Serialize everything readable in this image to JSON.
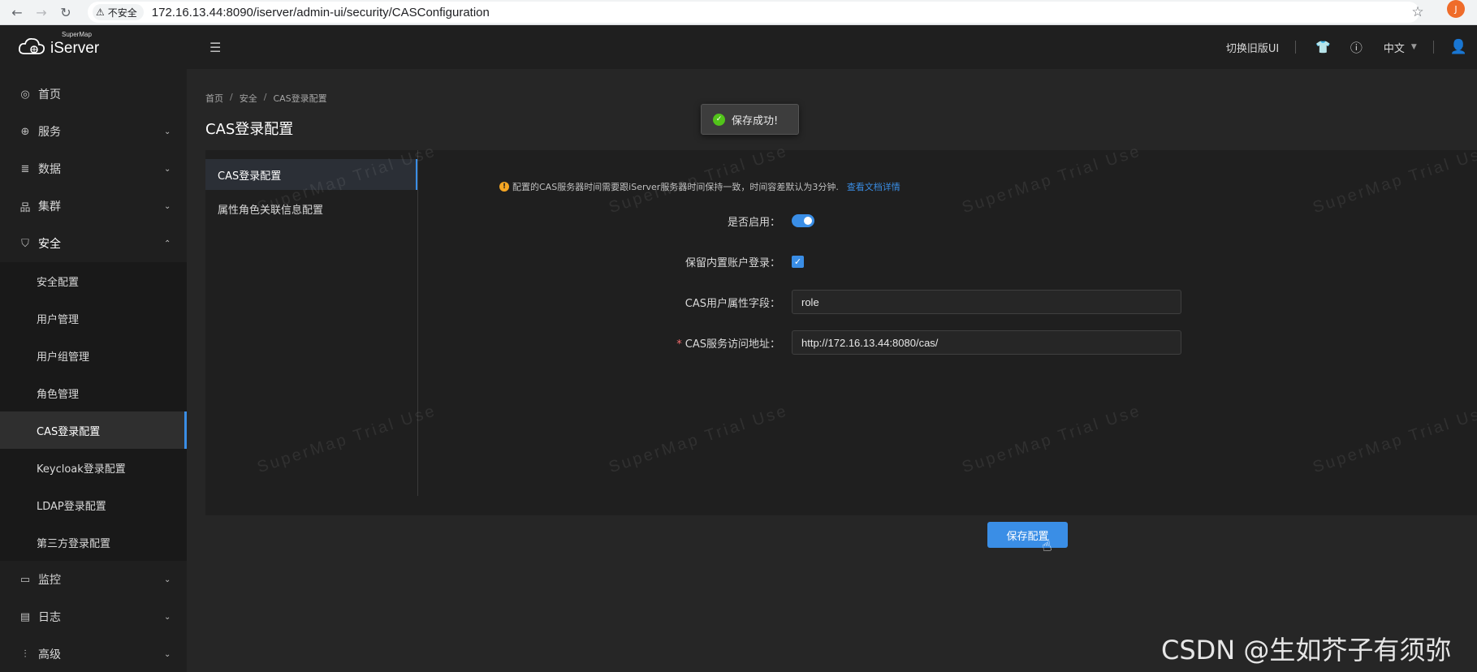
{
  "browser": {
    "security_label": "不安全",
    "url": "172.16.13.44:8090/iserver/admin-ui/security/CASConfiguration",
    "profile_initial": "J"
  },
  "header": {
    "logo_small": "SuperMap",
    "logo_big": "iServer",
    "switch_ui": "切换旧版UI",
    "language": "中文"
  },
  "sidebar": {
    "items": [
      {
        "label": "首页"
      },
      {
        "label": "服务"
      },
      {
        "label": "数据"
      },
      {
        "label": "集群"
      },
      {
        "label": "安全"
      }
    ],
    "security_sub": [
      {
        "label": "安全配置"
      },
      {
        "label": "用户管理"
      },
      {
        "label": "用户组管理"
      },
      {
        "label": "角色管理"
      },
      {
        "label": "CAS登录配置"
      },
      {
        "label": "Keycloak登录配置"
      },
      {
        "label": "LDAP登录配置"
      },
      {
        "label": "第三方登录配置"
      }
    ],
    "bottom_items": [
      {
        "label": "监控"
      },
      {
        "label": "日志"
      },
      {
        "label": "高级"
      }
    ]
  },
  "breadcrumb": {
    "home": "首页",
    "security": "安全",
    "current": "CAS登录配置"
  },
  "page": {
    "title": "CAS登录配置"
  },
  "sub_menu": {
    "items": [
      {
        "label": "CAS登录配置"
      },
      {
        "label": "属性角色关联信息配置"
      }
    ]
  },
  "notice": {
    "text": "配置的CAS服务器时间需要跟iServer服务器时间保持一致，时间容差默认为3分钟.",
    "link": "查看文档详情"
  },
  "form": {
    "enable_label": "是否启用：",
    "enable_value": true,
    "keep_builtin_label": "保留内置账户登录：",
    "keep_builtin_value": true,
    "attr_field_label": "CAS用户属性字段：",
    "attr_field_value": "role",
    "service_url_label": "CAS服务访问地址：",
    "service_url_value": "http://172.16.13.44:8080/cas/",
    "save_button": "保存配置"
  },
  "toast": {
    "message": "保存成功!"
  },
  "watermark": "SuperMap Trial Use",
  "overlay_caption": "CSDN @生如芥子有须弥",
  "colors": {
    "accent": "#3a8ee6",
    "success": "#52c41a",
    "warning": "#f5a623",
    "required": "#f56c6c"
  }
}
